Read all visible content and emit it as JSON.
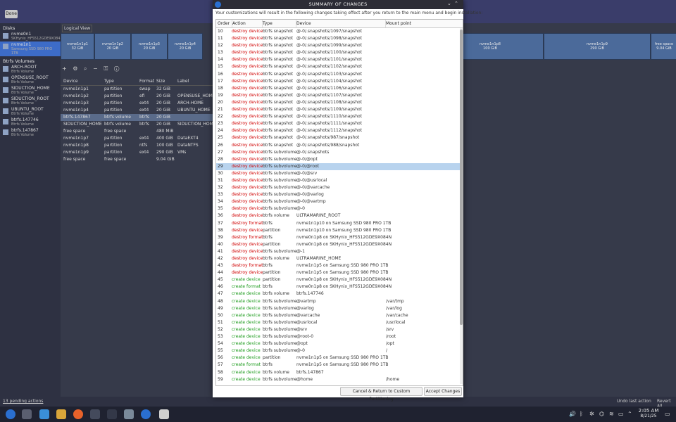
{
  "background": {
    "done_label": "Done",
    "left": {
      "disks_title": "Disks",
      "disks": [
        {
          "name": "nvme0n1",
          "sub": "SKHynix_HFS512GDE9X084N"
        },
        {
          "name": "nvme1n1",
          "sub": "Samsung SSD 980 PRO 1TB"
        }
      ],
      "btrfs_title": "Btrfs Volumes",
      "volumes": [
        {
          "name": "ARCH-ROOT",
          "sub": "Btrfs Volume"
        },
        {
          "name": "OPENSUSE_ROOT",
          "sub": "Btrfs Volume"
        },
        {
          "name": "SIDUCTION_HOME",
          "sub": "Btrfs Volume"
        },
        {
          "name": "SIDUCTION_ROOT",
          "sub": "Btrfs Volume"
        },
        {
          "name": "UBUNTU_ROOT",
          "sub": "Btrfs Volume"
        },
        {
          "name": "btrfs.147746",
          "sub": "Btrfs Volume"
        },
        {
          "name": "btrfs.147867",
          "sub": "Btrfs Volume"
        }
      ]
    },
    "logical_view": "Logical View",
    "bars": [
      {
        "name": "nvme1n1p1",
        "size": "32 GiB"
      },
      {
        "name": "nvme1n1p2",
        "size": "20 GiB"
      },
      {
        "name": "nvme1n1p3",
        "size": "20 GiB"
      },
      {
        "name": "nvme1n1p4",
        "size": "20 GiB"
      },
      {
        "name": "nvme1n1p8",
        "size": "100 GiB"
      },
      {
        "name": "nvme1n1p9",
        "size": "290 GiB"
      },
      {
        "name": "free space",
        "size": "9.04 GiB"
      }
    ],
    "ptable_headers": [
      "Device",
      "Type",
      "Format",
      "Size",
      "Label"
    ],
    "ptable_rows": [
      {
        "dev": "nvme1n1p1",
        "type": "partition",
        "fmt": "swap",
        "size": "32 GiB",
        "label": ""
      },
      {
        "dev": "nvme1n1p2",
        "type": "partition",
        "fmt": "efi",
        "size": "20 GiB",
        "label": "OPENSUSE_HOME"
      },
      {
        "dev": "nvme1n1p3",
        "type": "partition",
        "fmt": "ext4",
        "size": "20 GiB",
        "label": "ARCH-HOME"
      },
      {
        "dev": "nvme1n1p4",
        "type": "partition",
        "fmt": "ext4",
        "size": "20 GiB",
        "label": "UBUNTU_HOME"
      },
      {
        "dev": "btrfs.147867",
        "type": "btrfs volume",
        "fmt": "btrfs",
        "size": "20 GiB",
        "label": ""
      },
      {
        "dev": "SIDUCTION_HOME",
        "type": "btrfs volume",
        "fmt": "btrfs",
        "size": "20 GiB",
        "label": "SIDUCTION_HOME"
      },
      {
        "dev": "free space",
        "type": "free space",
        "fmt": "",
        "size": "480 MiB",
        "label": ""
      },
      {
        "dev": "nvme1n1p7",
        "type": "partition",
        "fmt": "ext4",
        "size": "400 GiB",
        "label": "DataEXT4"
      },
      {
        "dev": "nvme1n1p8",
        "type": "partition",
        "fmt": "ntfs",
        "size": "100 GiB",
        "label": "DataNTFS"
      },
      {
        "dev": "nvme1n1p9",
        "type": "partition",
        "fmt": "ext4",
        "size": "290 GiB",
        "label": "VMs"
      },
      {
        "dev": "free space",
        "type": "free space",
        "fmt": "",
        "size": "9.04 GiB",
        "label": ""
      }
    ],
    "pending": "13 pending actions",
    "undo": "Undo last action",
    "revert": "Revert All"
  },
  "taskbar": {
    "time": "2:05 AM",
    "date": "8/21/25"
  },
  "dialog": {
    "title": "SUMMARY OF CHANGES",
    "description": "Your customizations will result in the following changes taking effect after you return to the main menu and begin installation:",
    "columns": [
      "Order",
      "Action",
      "Type",
      "Device",
      "Mount point"
    ],
    "selected_order": "29",
    "rows": [
      {
        "o": "10",
        "a": "destroy device",
        "t": "btrfs snapshot",
        "d": "@-0/.snapshots/1097/snapshot",
        "m": ""
      },
      {
        "o": "11",
        "a": "destroy device",
        "t": "btrfs snapshot",
        "d": "@-0/.snapshots/1098/snapshot",
        "m": ""
      },
      {
        "o": "12",
        "a": "destroy device",
        "t": "btrfs snapshot",
        "d": "@-0/.snapshots/1099/snapshot",
        "m": ""
      },
      {
        "o": "13",
        "a": "destroy device",
        "t": "btrfs snapshot",
        "d": "@-0/.snapshots/1100/snapshot",
        "m": ""
      },
      {
        "o": "14",
        "a": "destroy device",
        "t": "btrfs snapshot",
        "d": "@-0/.snapshots/1101/snapshot",
        "m": ""
      },
      {
        "o": "15",
        "a": "destroy device",
        "t": "btrfs snapshot",
        "d": "@-0/.snapshots/1102/snapshot",
        "m": ""
      },
      {
        "o": "16",
        "a": "destroy device",
        "t": "btrfs snapshot",
        "d": "@-0/.snapshots/1103/snapshot",
        "m": ""
      },
      {
        "o": "17",
        "a": "destroy device",
        "t": "btrfs snapshot",
        "d": "@-0/.snapshots/1104/snapshot",
        "m": ""
      },
      {
        "o": "18",
        "a": "destroy device",
        "t": "btrfs snapshot",
        "d": "@-0/.snapshots/1106/snapshot",
        "m": ""
      },
      {
        "o": "19",
        "a": "destroy device",
        "t": "btrfs snapshot",
        "d": "@-0/.snapshots/1107/snapshot",
        "m": ""
      },
      {
        "o": "20",
        "a": "destroy device",
        "t": "btrfs snapshot",
        "d": "@-0/.snapshots/1108/snapshot",
        "m": ""
      },
      {
        "o": "21",
        "a": "destroy device",
        "t": "btrfs snapshot",
        "d": "@-0/.snapshots/1109/snapshot",
        "m": ""
      },
      {
        "o": "22",
        "a": "destroy device",
        "t": "btrfs snapshot",
        "d": "@-0/.snapshots/1110/snapshot",
        "m": ""
      },
      {
        "o": "23",
        "a": "destroy device",
        "t": "btrfs snapshot",
        "d": "@-0/.snapshots/1111/snapshot",
        "m": ""
      },
      {
        "o": "24",
        "a": "destroy device",
        "t": "btrfs snapshot",
        "d": "@-0/.snapshots/1112/snapshot",
        "m": ""
      },
      {
        "o": "25",
        "a": "destroy device",
        "t": "btrfs snapshot",
        "d": "@-0/.snapshots/987/snapshot",
        "m": ""
      },
      {
        "o": "26",
        "a": "destroy device",
        "t": "btrfs snapshot",
        "d": "@-0/.snapshots/988/snapshot",
        "m": ""
      },
      {
        "o": "27",
        "a": "destroy device",
        "t": "btrfs subvolume",
        "d": "@-0/.snapshots",
        "m": ""
      },
      {
        "o": "28",
        "a": "destroy device",
        "t": "btrfs subvolume",
        "d": "@-0/@opt",
        "m": ""
      },
      {
        "o": "29",
        "a": "destroy device",
        "t": "btrfs subvolume",
        "d": "@-0/@root",
        "m": ""
      },
      {
        "o": "30",
        "a": "destroy device",
        "t": "btrfs subvolume",
        "d": "@-0/@srv",
        "m": ""
      },
      {
        "o": "31",
        "a": "destroy device",
        "t": "btrfs subvolume",
        "d": "@-0/@usrlocal",
        "m": ""
      },
      {
        "o": "32",
        "a": "destroy device",
        "t": "btrfs subvolume",
        "d": "@-0/@varcache",
        "m": ""
      },
      {
        "o": "33",
        "a": "destroy device",
        "t": "btrfs subvolume",
        "d": "@-0/@varlog",
        "m": ""
      },
      {
        "o": "34",
        "a": "destroy device",
        "t": "btrfs subvolume",
        "d": "@-0/@vartmp",
        "m": ""
      },
      {
        "o": "35",
        "a": "destroy device",
        "t": "btrfs subvolume",
        "d": "@-0",
        "m": ""
      },
      {
        "o": "36",
        "a": "destroy device",
        "t": "btrfs volume",
        "d": "ULTRAMARINE_ROOT",
        "m": ""
      },
      {
        "o": "37",
        "a": "destroy format",
        "t": "btrfs",
        "d": "nvme1n1p10 on Samsung SSD 980 PRO 1TB",
        "m": ""
      },
      {
        "o": "38",
        "a": "destroy device",
        "t": "partition",
        "d": "nvme1n1p10 on Samsung SSD 980 PRO 1TB",
        "m": ""
      },
      {
        "o": "39",
        "a": "destroy format",
        "t": "btrfs",
        "d": "nvme0n1p8 on SKHynix_HFS512GDE9X084N",
        "m": ""
      },
      {
        "o": "40",
        "a": "destroy device",
        "t": "partition",
        "d": "nvme0n1p8 on SKHynix_HFS512GDE9X084N",
        "m": ""
      },
      {
        "o": "41",
        "a": "destroy device",
        "t": "btrfs subvolume",
        "d": "@-1",
        "m": ""
      },
      {
        "o": "42",
        "a": "destroy device",
        "t": "btrfs volume",
        "d": "ULTRAMARINE_HOME",
        "m": ""
      },
      {
        "o": "43",
        "a": "destroy format",
        "t": "btrfs",
        "d": "nvme1n1p5 on Samsung SSD 980 PRO 1TB",
        "m": ""
      },
      {
        "o": "44",
        "a": "destroy device",
        "t": "partition",
        "d": "nvme1n1p5 on Samsung SSD 980 PRO 1TB",
        "m": ""
      },
      {
        "o": "45",
        "a": "create device",
        "t": "partition",
        "d": "nvme0n1p8 on SKHynix_HFS512GDE9X084N",
        "m": ""
      },
      {
        "o": "46",
        "a": "create format",
        "t": "btrfs",
        "d": "nvme0n1p8 on SKHynix_HFS512GDE9X084N",
        "m": ""
      },
      {
        "o": "47",
        "a": "create device",
        "t": "btrfs volume",
        "d": "btrfs.147746",
        "m": ""
      },
      {
        "o": "48",
        "a": "create device",
        "t": "btrfs subvolume",
        "d": "@vartmp",
        "m": "/var/tmp"
      },
      {
        "o": "49",
        "a": "create device",
        "t": "btrfs subvolume",
        "d": "@varlog",
        "m": "/var/log"
      },
      {
        "o": "50",
        "a": "create device",
        "t": "btrfs subvolume",
        "d": "@varcache",
        "m": "/var/cache"
      },
      {
        "o": "51",
        "a": "create device",
        "t": "btrfs subvolume",
        "d": "@usrlocal",
        "m": "/usr/local"
      },
      {
        "o": "52",
        "a": "create device",
        "t": "btrfs subvolume",
        "d": "@srv",
        "m": "/srv"
      },
      {
        "o": "53",
        "a": "create device",
        "t": "btrfs subvolume",
        "d": "@root-0",
        "m": "/root"
      },
      {
        "o": "54",
        "a": "create device",
        "t": "btrfs subvolume",
        "d": "@opt",
        "m": "/opt"
      },
      {
        "o": "55",
        "a": "create device",
        "t": "btrfs subvolume",
        "d": "@-0",
        "m": "/"
      },
      {
        "o": "56",
        "a": "create device",
        "t": "partition",
        "d": "nvme1n1p5 on Samsung SSD 980 PRO 1TB",
        "m": ""
      },
      {
        "o": "57",
        "a": "create format",
        "t": "btrfs",
        "d": "nvme1n1p5 on Samsung SSD 980 PRO 1TB",
        "m": ""
      },
      {
        "o": "58",
        "a": "create device",
        "t": "btrfs volume",
        "d": "btrfs.147867",
        "m": ""
      },
      {
        "o": "59",
        "a": "create device",
        "t": "btrfs subvolume",
        "d": "@home",
        "m": "/home"
      }
    ],
    "cancel_label": "Cancel & Return to Custom Partitioning",
    "accept_label": "Accept Changes"
  }
}
